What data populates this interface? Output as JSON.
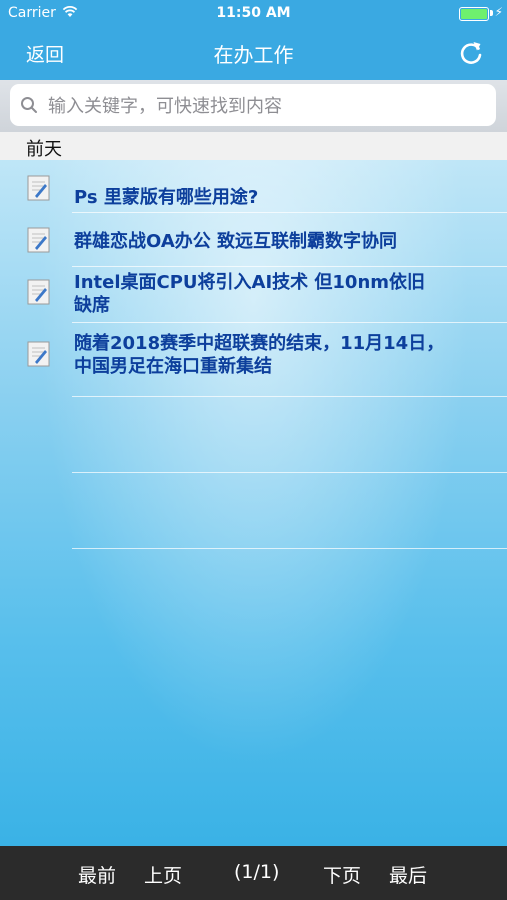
{
  "status_bar": {
    "carrier": "Carrier",
    "time": "11:50 AM"
  },
  "header": {
    "back_label": "返回",
    "title": "在办工作"
  },
  "search": {
    "placeholder": "输入关键字，可快速找到内容"
  },
  "section": {
    "label": "前天"
  },
  "items": [
    {
      "title": "Ps 里蒙版有哪些用途?"
    },
    {
      "title": "群雄恋战OA办公 致远互联制霸数字协同"
    },
    {
      "title": "Intel桌面CPU将引入AI技术 但10nm依旧缺席"
    },
    {
      "title": "随着2018赛季中超联赛的结束，11月14日，中国男足在海口重新集结"
    }
  ],
  "footer": {
    "first_label": "最前",
    "prev_label": "上页",
    "page_indicator": "(1/1)",
    "next_label": "下页",
    "last_label": "最后"
  },
  "colors": {
    "header_bg": "#3aa9e2",
    "item_text": "#0d3f9c",
    "footer_bg": "#2b2b2b",
    "battery": "#6ef06e"
  },
  "icons": [
    "wifi-icon",
    "battery-icon",
    "refresh-icon",
    "search-icon",
    "document-icon"
  ]
}
